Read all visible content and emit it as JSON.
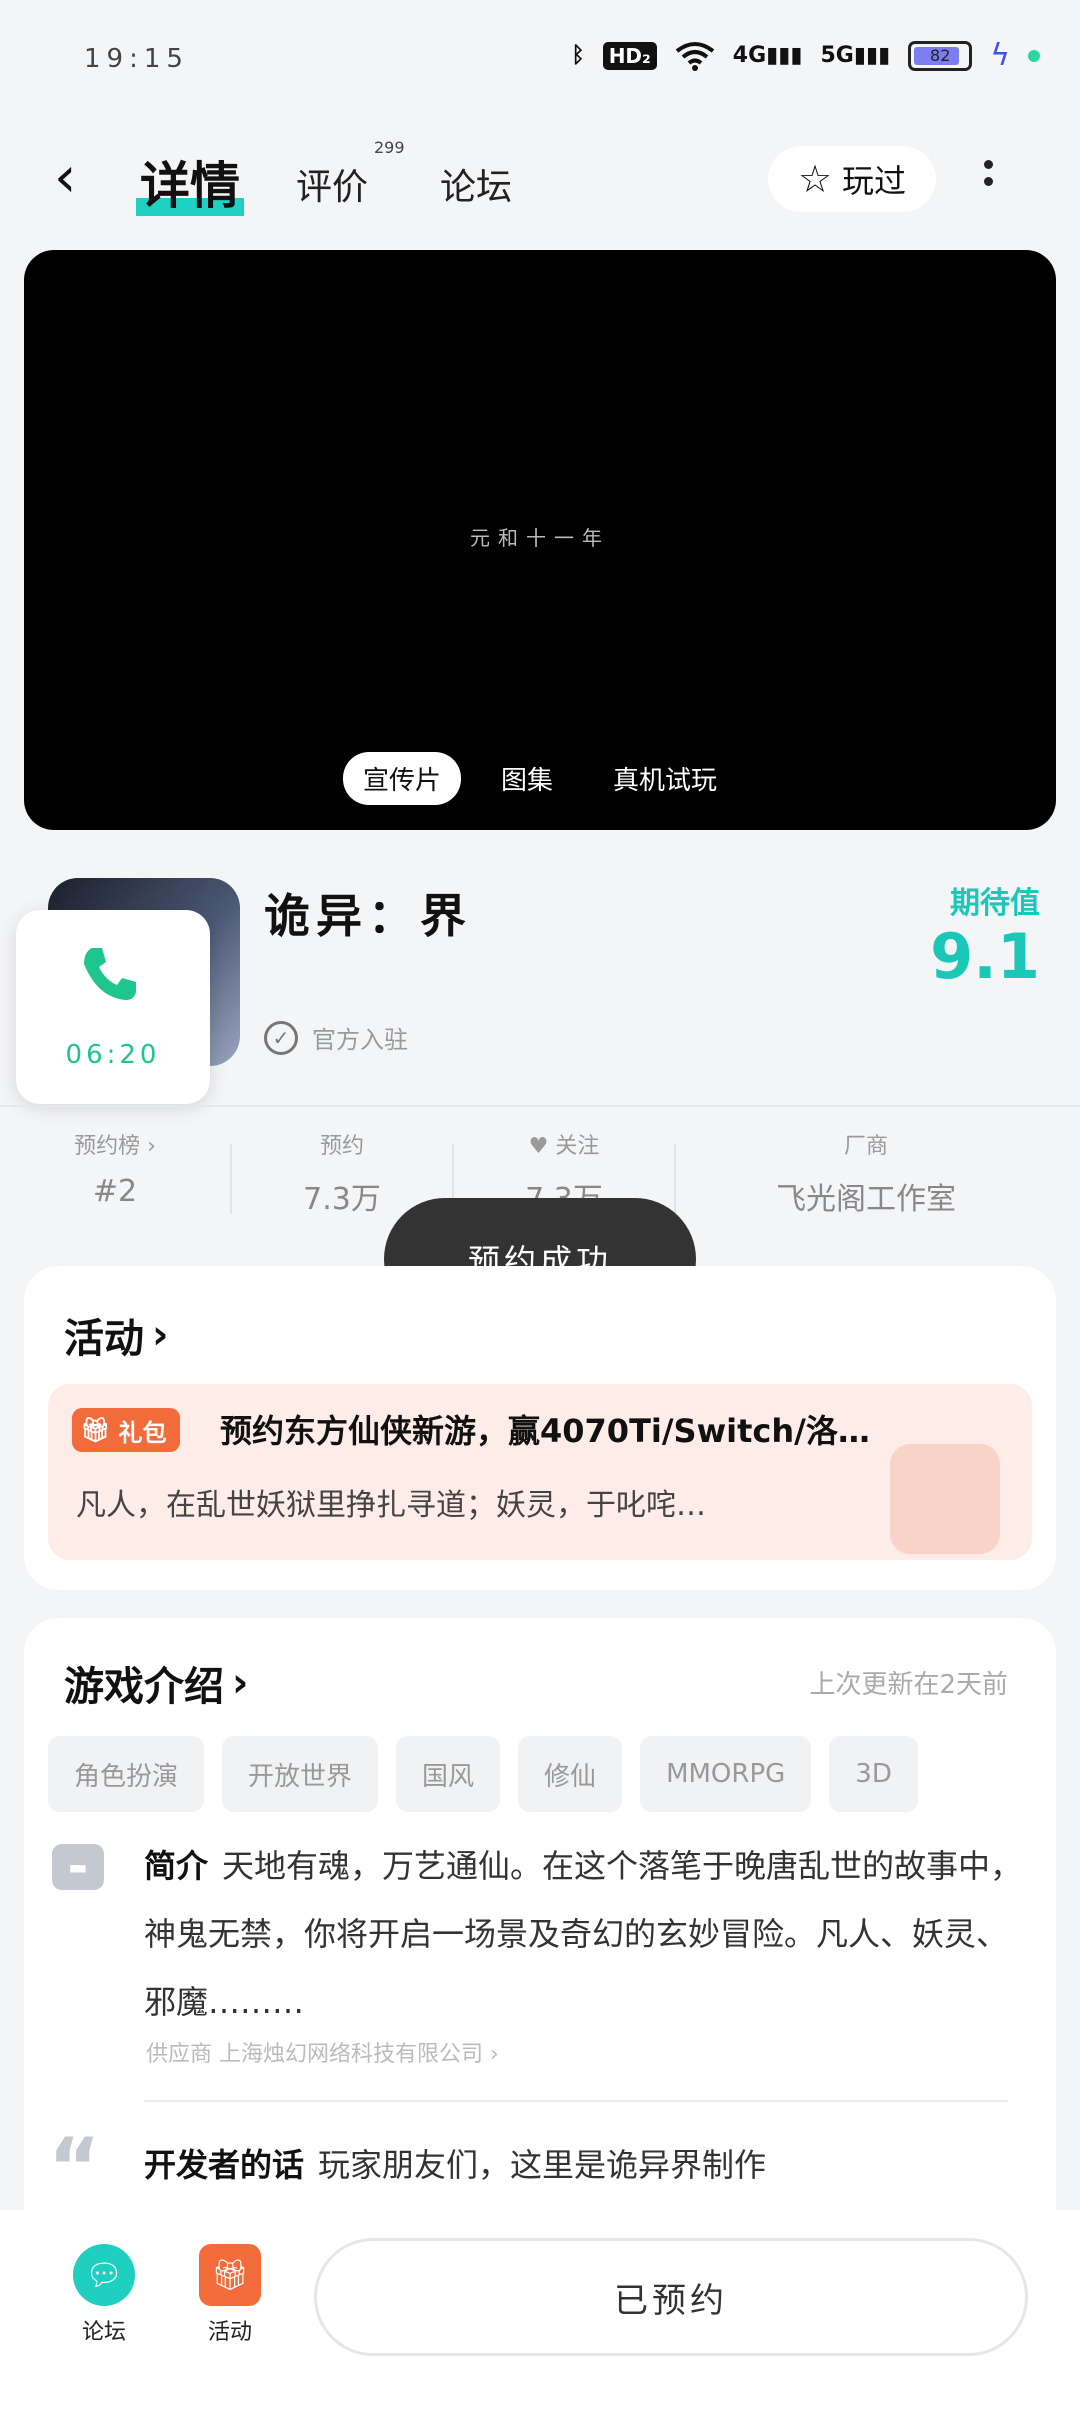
{
  "status_bar": {
    "time": "19:15",
    "network_hd": "HD₂",
    "net_4g": "4G",
    "net_5g": "5G",
    "battery": "82"
  },
  "nav": {
    "tab_detail": "详情",
    "tab_reviews": "评价",
    "reviews_count": "299",
    "tab_forum": "论坛",
    "played_label": "玩过"
  },
  "video": {
    "caption": "元和十一年",
    "tabs": [
      "宣传片",
      "图集",
      "真机试玩"
    ]
  },
  "game": {
    "name": "诡异：界",
    "official_label": "官方入驻",
    "expect_label": "期待值",
    "expect_score": "9.1"
  },
  "call": {
    "time": "06:20"
  },
  "stats": [
    {
      "label": "预约榜 ›",
      "value": "#2"
    },
    {
      "label": "预约",
      "value": "7.3万"
    },
    {
      "label": "关注",
      "value": "7.3万"
    },
    {
      "label": "厂商",
      "value": "飞光阁工作室"
    }
  ],
  "toast": "预约成功",
  "activity": {
    "title": "活动",
    "badge": "礼包",
    "line1": "预约东方仙侠新游，赢4070Ti/Switch/洛…",
    "line2": "凡人，在乱世妖狱里挣扎寻道；妖灵，于叱咤…"
  },
  "intro": {
    "title": "游戏介绍",
    "updated": "上次更新在2天前",
    "tags": [
      "角色扮演",
      "开放世界",
      "国风",
      "修仙",
      "MMORPG",
      "3D"
    ],
    "intro_label": "简介",
    "intro_text": "天地有魂，万艺通仙。在这个落笔于晚唐乱世的故事中，神鬼无禁，你将开启一场景及奇幻的玄妙冒险。凡人、妖灵、邪魔………",
    "developer": "供应商 上海烛幻网络科技有限公司 ›",
    "dev_words_label": "开发者的话",
    "dev_words_text": "玩家朋友们，这里是诡异界制作"
  },
  "bottom": {
    "forum_label": "论坛",
    "activity_label": "活动",
    "reserve_label": "已预约"
  },
  "colors": {
    "accent": "#1bc8b7",
    "promo_orange": "#f26b3a",
    "call_green": "#1ec58c"
  }
}
